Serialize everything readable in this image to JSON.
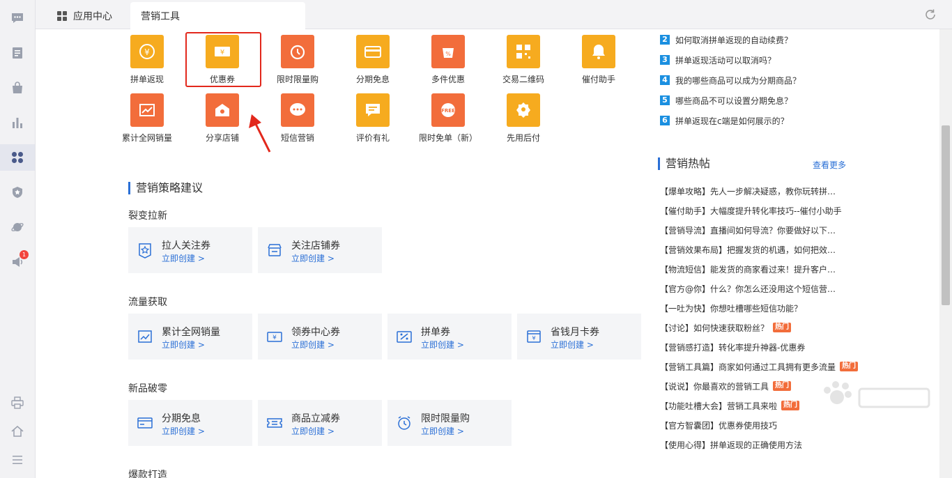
{
  "sidebar": {
    "badge_count": "1"
  },
  "tabs": {
    "app_center": "应用中心",
    "marketing_tools": "营销工具"
  },
  "tools": [
    {
      "name": "拼单返现",
      "icon": "coin-return-icon",
      "color": "#f6ab1f"
    },
    {
      "name": "优惠券",
      "icon": "coupon-icon",
      "color": "#f6ab1f"
    },
    {
      "name": "限时限量购",
      "icon": "alarm-clock-icon",
      "color": "#f26d3b"
    },
    {
      "name": "分期免息",
      "icon": "card-installment-icon",
      "color": "#f6ab1f"
    },
    {
      "name": "多件优惠",
      "icon": "multi-item-discount-icon",
      "color": "#f26d3b"
    },
    {
      "name": "交易二维码",
      "icon": "qr-code-icon",
      "color": "#f6ab1f"
    },
    {
      "name": "催付助手",
      "icon": "bell-icon",
      "color": "#f6ab1f"
    },
    {
      "name": "累计全网销量",
      "icon": "sales-trend-icon",
      "color": "#f26d3b"
    },
    {
      "name": "分享店铺",
      "icon": "share-shop-icon",
      "color": "#f26d3b"
    },
    {
      "name": "短信营销",
      "icon": "sms-bubble-icon",
      "color": "#f26d3b"
    },
    {
      "name": "评价有礼",
      "icon": "review-gift-icon",
      "color": "#f6ab1f"
    },
    {
      "name": "限时免单（新）",
      "icon": "free-order-icon",
      "color": "#f26d3b"
    },
    {
      "name": "先用后付",
      "icon": "use-first-pay-later-icon",
      "color": "#f6ab1f"
    }
  ],
  "strategy": {
    "title": "营销策略建议",
    "create_label": "立即创建 >",
    "categories": [
      {
        "title": "裂变拉新",
        "items": [
          {
            "name": "拉人关注券",
            "icon": "star-badge-icon"
          },
          {
            "name": "关注店铺券",
            "icon": "shop-follow-icon"
          }
        ]
      },
      {
        "title": "流量获取",
        "items": [
          {
            "name": "累计全网销量",
            "icon": "line-chart-icon"
          },
          {
            "name": "领券中心券",
            "icon": "coupon-center-icon"
          },
          {
            "name": "拼单券",
            "icon": "group-coupon-icon"
          },
          {
            "name": "省钱月卡券",
            "icon": "month-card-icon"
          }
        ]
      },
      {
        "title": "新品破零",
        "items": [
          {
            "name": "分期免息",
            "icon": "card-icon"
          },
          {
            "name": "商品立减券",
            "icon": "instant-discount-icon"
          },
          {
            "name": "限时限量购",
            "icon": "clock-icon"
          }
        ]
      },
      {
        "title": "爆款打造",
        "items": []
      }
    ]
  },
  "faq": [
    {
      "num": "2",
      "text": "如何取消拼单返现的自动续费？"
    },
    {
      "num": "3",
      "text": "拼单返现活动可以取消吗？"
    },
    {
      "num": "4",
      "text": "我的哪些商品可以成为分期商品？"
    },
    {
      "num": "5",
      "text": "哪些商品不可以设置分期免息？"
    },
    {
      "num": "6",
      "text": "拼单返现在c端是如何展示的？"
    }
  ],
  "hot_posts": {
    "title": "营销热帖",
    "more": "查看更多",
    "hot_badge": "热门",
    "items": [
      {
        "text": "【爆单攻略】先人一步解决疑惑，教你玩转拼单返现",
        "hot": false
      },
      {
        "text": "【催付助手】大幅度提升转化率技巧--催付小助手",
        "hot": false
      },
      {
        "text": "【营销导流】直播间如何导流？你要做好以下几点",
        "hot": false
      },
      {
        "text": "【营销效果布局】把握发货的机遇，如何把效果做大",
        "hot": false
      },
      {
        "text": "【物流短信】能发货的商家看过来！提升客户物流体验",
        "hot": false
      },
      {
        "text": "【官方@你】什么？你怎么还没用这个短信营销工具",
        "hot": false
      },
      {
        "text": "【一吐为快】你想吐槽哪些短信功能？",
        "hot": false
      },
      {
        "text": "【讨论】如何快速获取粉丝？",
        "hot": true
      },
      {
        "text": "【营销感打造】转化率提升神器-优惠券",
        "hot": false
      },
      {
        "text": "【营销工具篇】商家如何通过工具拥有更多流量",
        "hot": true
      },
      {
        "text": "【说说】你最喜欢的营销工具",
        "hot": true
      },
      {
        "text": "【功能吐槽大会】营销工具来啦",
        "hot": true
      },
      {
        "text": "【官方智囊团】优惠券使用技巧",
        "hot": false
      },
      {
        "text": "【使用心得】拼单返现的正确使用方法",
        "hot": false
      }
    ]
  },
  "colors": {
    "accent": "#2a6fd6",
    "gold": "#f6ab1f",
    "orange": "#f26d3b",
    "highlight": "#e2281c"
  }
}
